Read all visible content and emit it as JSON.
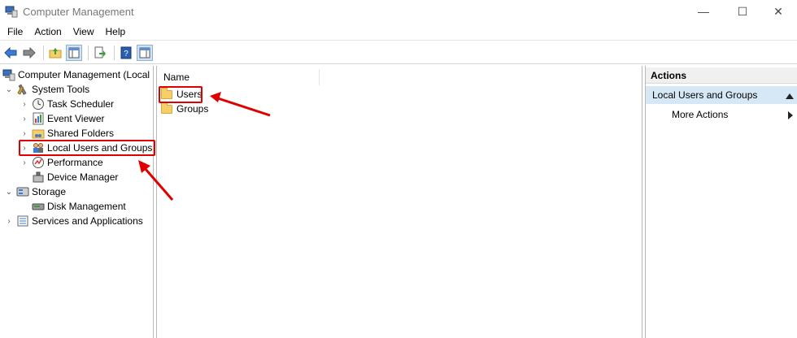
{
  "window": {
    "title": "Computer Management",
    "minimize_icon": "minimize-icon",
    "maximize_icon": "maximize-icon",
    "close_icon": "close-icon"
  },
  "menu": [
    "File",
    "Action",
    "View",
    "Help"
  ],
  "tree": {
    "root": "Computer Management (Local",
    "system_tools": "System Tools",
    "task_scheduler": "Task Scheduler",
    "event_viewer": "Event Viewer",
    "shared_folders": "Shared Folders",
    "local_users_groups": "Local Users and Groups",
    "performance": "Performance",
    "device_manager": "Device Manager",
    "storage": "Storage",
    "disk_management": "Disk Management",
    "services_apps": "Services and Applications"
  },
  "list": {
    "column_name": "Name",
    "items": [
      "Users",
      "Groups"
    ]
  },
  "actions": {
    "header": "Actions",
    "section": "Local Users and Groups",
    "more_actions": "More Actions"
  },
  "colors": {
    "annotation_red": "#e00000",
    "selection_blue": "#d6e8f6",
    "folder_yellow": "#f5cf6a"
  }
}
